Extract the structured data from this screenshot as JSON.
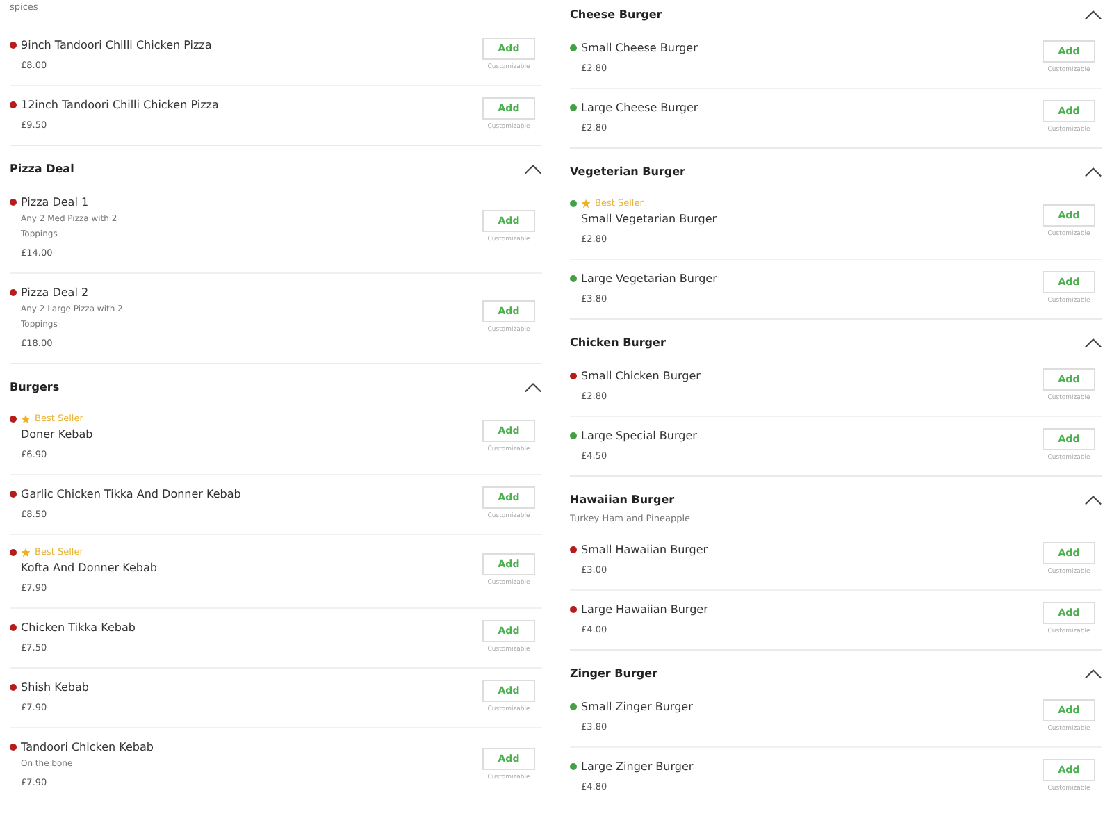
{
  "columns": [
    {
      "sections": [
        {
          "description": "spices",
          "items": [
            {
              "color": "#b71c1c",
              "name": "9inch Tandoori Chilli Chicken Pizza",
              "price": "£8.00",
              "button": "Add",
              "note": "Customizable"
            },
            {
              "color": "#b71c1c",
              "name": "12inch Tandoori Chilli Chicken Pizza",
              "price": "£9.50",
              "button": "Add",
              "note": "Customizable"
            }
          ]
        },
        {
          "title": "Pizza Deal",
          "expanded": true,
          "items": [
            {
              "color": "#b71c1c",
              "name": "Pizza Deal 1",
              "description": "Any 2 Med Pizza with 2 Toppings",
              "price": "£14.00",
              "button": "Add",
              "note": "Customizable"
            },
            {
              "color": "#b71c1c",
              "name": "Pizza Deal 2",
              "description": "Any 2 Large Pizza with 2 Toppings",
              "price": "£18.00",
              "button": "Add",
              "note": "Customizable"
            }
          ]
        },
        {
          "title": "Burgers",
          "expanded": true,
          "items": [
            {
              "color": "#b71c1c",
              "badge": "Best Seller",
              "name": "Doner Kebab",
              "price": "£6.90",
              "button": "Add",
              "note": "Customizable"
            },
            {
              "color": "#b71c1c",
              "name": "Garlic Chicken Tikka And Donner Kebab",
              "price": "£8.50",
              "button": "Add",
              "note": "Customizable"
            },
            {
              "color": "#b71c1c",
              "badge": "Best Seller",
              "name": "Kofta And Donner Kebab",
              "price": "£7.90",
              "button": "Add",
              "note": "Customizable"
            },
            {
              "color": "#b71c1c",
              "name": "Chicken Tikka Kebab",
              "price": "£7.50",
              "button": "Add",
              "note": "Customizable"
            },
            {
              "color": "#b71c1c",
              "name": "Shish Kebab",
              "price": "£7.90",
              "button": "Add",
              "note": "Customizable"
            },
            {
              "color": "#b71c1c",
              "name": "Tandoori Chicken Kebab",
              "description": "On the bone",
              "price": "£7.90",
              "button": "Add",
              "note": "Customizable"
            }
          ]
        }
      ]
    },
    {
      "sections": [
        {
          "title": "Cheese Burger",
          "expanded": true,
          "items": [
            {
              "color": "#43a047",
              "name": "Small Cheese Burger",
              "price": "£2.80",
              "button": "Add",
              "note": "Customizable"
            },
            {
              "color": "#43a047",
              "name": "Large Cheese Burger",
              "price": "£2.80",
              "button": "Add",
              "note": "Customizable"
            }
          ]
        },
        {
          "title": "Vegeterian Burger",
          "expanded": true,
          "items": [
            {
              "color": "#43a047",
              "badge": "Best Seller",
              "name": "Small Vegetarian Burger",
              "price": "£2.80",
              "button": "Add",
              "note": "Customizable"
            },
            {
              "color": "#43a047",
              "name": "Large Vegetarian Burger",
              "price": "£3.80",
              "button": "Add",
              "note": "Customizable"
            }
          ]
        },
        {
          "title": "Chicken Burger",
          "expanded": true,
          "items": [
            {
              "color": "#b71c1c",
              "name": "Small Chicken Burger",
              "price": "£2.80",
              "button": "Add",
              "note": "Customizable"
            },
            {
              "color": "#43a047",
              "name": "Large Special Burger",
              "price": "£4.50",
              "button": "Add",
              "note": "Customizable"
            }
          ]
        },
        {
          "title": "Hawaiian Burger",
          "description": "Turkey Ham and Pineapple",
          "expanded": true,
          "items": [
            {
              "color": "#b71c1c",
              "name": "Small Hawaiian Burger",
              "price": "£3.00",
              "button": "Add",
              "note": "Customizable"
            },
            {
              "color": "#b71c1c",
              "name": "Large Hawaiian Burger",
              "price": "£4.00",
              "button": "Add",
              "note": "Customizable"
            }
          ]
        },
        {
          "title": "Zinger Burger",
          "expanded": true,
          "items": [
            {
              "color": "#43a047",
              "name": "Small Zinger Burger",
              "price": "£3.80",
              "button": "Add",
              "note": "Customizable"
            },
            {
              "color": "#43a047",
              "name": "Large Zinger Burger",
              "price": "£4.80",
              "button": "Add",
              "note": "Customizable"
            }
          ]
        }
      ]
    }
  ]
}
